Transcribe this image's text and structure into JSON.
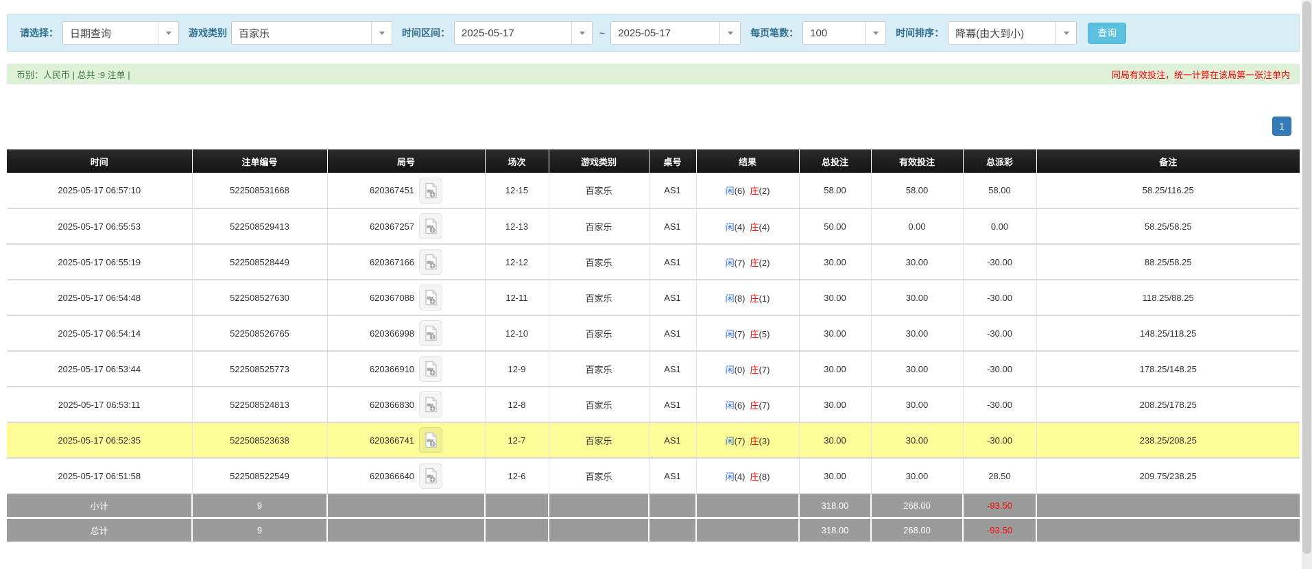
{
  "filter": {
    "select_label": "请选择：",
    "select_value": "日期查询",
    "game_label": "游戏类别",
    "game_value": "百家乐",
    "range_label": "时间区间：",
    "date_from": "2025-05-17",
    "tilde": "~",
    "date_to": "2025-05-17",
    "pagesize_label": "每页笔数：",
    "pagesize_value": "100",
    "sort_label": "时间排序：",
    "sort_value": "降冪(由大到小)",
    "search_button": "查询"
  },
  "summary": {
    "left": "币别：人民币 | 总共 :9 注单 |",
    "right": "同局有效投注，统一计算在该局第一张注单内"
  },
  "pagination": {
    "page": "1"
  },
  "table": {
    "headers": [
      "时间",
      "注单编号",
      "局号",
      "场次",
      "游戏类别",
      "桌号",
      "结果",
      "总投注",
      "有效投注",
      "总派彩",
      "备注"
    ],
    "rows": [
      {
        "time": "2025-05-17 06:57:10",
        "bet_id": "522508531668",
        "round": "620367451",
        "session": "12-15",
        "game": "百家乐",
        "table": "AS1",
        "player_label": "闲",
        "player_score": "(6)",
        "banker_label": "庄",
        "banker_score": "(2)",
        "total_bet": "58.00",
        "valid_bet": "58.00",
        "payout": "58.00",
        "note": "58.25/116.25",
        "highlight": false
      },
      {
        "time": "2025-05-17 06:55:53",
        "bet_id": "522508529413",
        "round": "620367257",
        "session": "12-13",
        "game": "百家乐",
        "table": "AS1",
        "player_label": "闲",
        "player_score": "(4)",
        "banker_label": "庄",
        "banker_score": "(4)",
        "total_bet": "50.00",
        "valid_bet": "0.00",
        "payout": "0.00",
        "note": "58.25/58.25",
        "highlight": false
      },
      {
        "time": "2025-05-17 06:55:19",
        "bet_id": "522508528449",
        "round": "620367166",
        "session": "12-12",
        "game": "百家乐",
        "table": "AS1",
        "player_label": "闲",
        "player_score": "(7)",
        "banker_label": "庄",
        "banker_score": "(2)",
        "total_bet": "30.00",
        "valid_bet": "30.00",
        "payout": "-30.00",
        "note": "88.25/58.25",
        "highlight": false
      },
      {
        "time": "2025-05-17 06:54:48",
        "bet_id": "522508527630",
        "round": "620367088",
        "session": "12-11",
        "game": "百家乐",
        "table": "AS1",
        "player_label": "闲",
        "player_score": "(8)",
        "banker_label": "庄",
        "banker_score": "(1)",
        "total_bet": "30.00",
        "valid_bet": "30.00",
        "payout": "-30.00",
        "note": "118.25/88.25",
        "highlight": false
      },
      {
        "time": "2025-05-17 06:54:14",
        "bet_id": "522508526765",
        "round": "620366998",
        "session": "12-10",
        "game": "百家乐",
        "table": "AS1",
        "player_label": "闲",
        "player_score": "(7)",
        "banker_label": "庄",
        "banker_score": "(5)",
        "total_bet": "30.00",
        "valid_bet": "30.00",
        "payout": "-30.00",
        "note": "148.25/118.25",
        "highlight": false
      },
      {
        "time": "2025-05-17 06:53:44",
        "bet_id": "522508525773",
        "round": "620366910",
        "session": "12-9",
        "game": "百家乐",
        "table": "AS1",
        "player_label": "闲",
        "player_score": "(0)",
        "banker_label": "庄",
        "banker_score": "(7)",
        "total_bet": "30.00",
        "valid_bet": "30.00",
        "payout": "-30.00",
        "note": "178.25/148.25",
        "highlight": false
      },
      {
        "time": "2025-05-17 06:53:11",
        "bet_id": "522508524813",
        "round": "620366830",
        "session": "12-8",
        "game": "百家乐",
        "table": "AS1",
        "player_label": "闲",
        "player_score": "(6)",
        "banker_label": "庄",
        "banker_score": "(7)",
        "total_bet": "30.00",
        "valid_bet": "30.00",
        "payout": "-30.00",
        "note": "208.25/178.25",
        "highlight": false
      },
      {
        "time": "2025-05-17 06:52:35",
        "bet_id": "522508523638",
        "round": "620366741",
        "session": "12-7",
        "game": "百家乐",
        "table": "AS1",
        "player_label": "闲",
        "player_score": "(7)",
        "banker_label": "庄",
        "banker_score": "(3)",
        "total_bet": "30.00",
        "valid_bet": "30.00",
        "payout": "-30.00",
        "note": "238.25/208.25",
        "highlight": true
      },
      {
        "time": "2025-05-17 06:51:58",
        "bet_id": "522508522549",
        "round": "620366640",
        "session": "12-6",
        "game": "百家乐",
        "table": "AS1",
        "player_label": "闲",
        "player_score": "(4)",
        "banker_label": "庄",
        "banker_score": "(8)",
        "total_bet": "30.00",
        "valid_bet": "30.00",
        "payout": "28.50",
        "note": "209.75/238.25",
        "highlight": false
      }
    ],
    "subtotal": {
      "label": "小计",
      "count": "9",
      "total_bet": "318.00",
      "valid_bet": "268.00",
      "payout": "-93.50"
    },
    "total": {
      "label": "总计",
      "count": "9",
      "total_bet": "318.00",
      "valid_bet": "268.00",
      "payout": "-93.50"
    }
  },
  "colors": {
    "filter_bar_bg": "#d9edf7",
    "filter_label": "#31708f",
    "summary_bar_bg": "#dff0d8",
    "summary_text": "#3c763d",
    "notice_red": "#ff0000",
    "header_bg": "#1c1c1c",
    "highlight_row": "#fbfb98",
    "totals_row_bg": "#9b9b9b",
    "accent_blue": "#2b6fdb",
    "banker_red": "#ff0000",
    "search_button_bg": "#5bc0de",
    "page_button_bg": "#337ab7"
  }
}
